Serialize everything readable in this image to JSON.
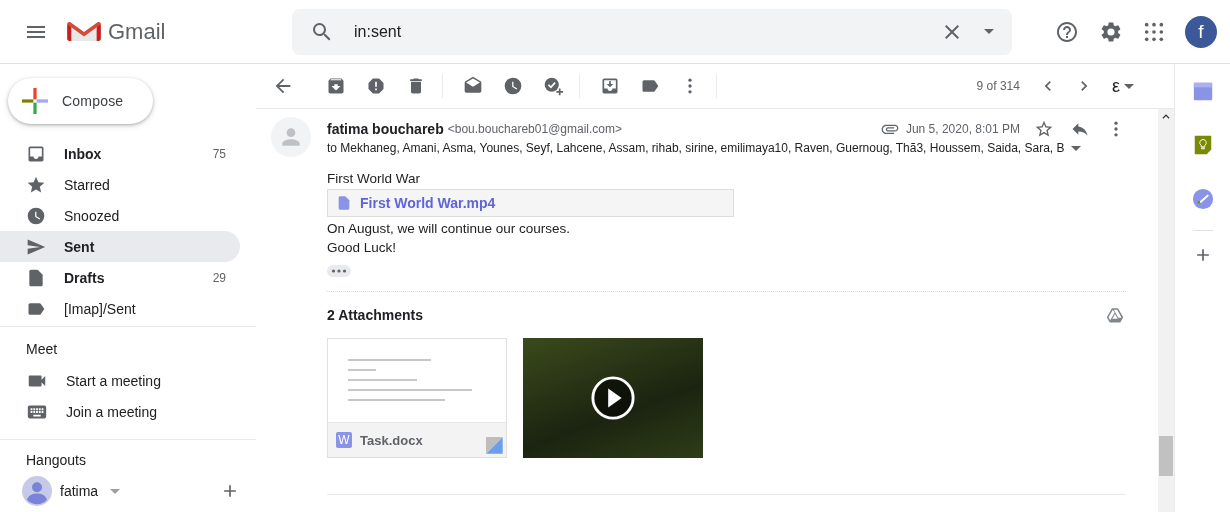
{
  "header": {
    "app_name": "Gmail",
    "search": {
      "value": "in:sent"
    },
    "avatar_letter": "f"
  },
  "compose": {
    "label": "Compose"
  },
  "folders": [
    {
      "kind": "inbox",
      "label": "Inbox",
      "count": "75",
      "unread": true,
      "selected": false
    },
    {
      "kind": "starred",
      "label": "Starred",
      "unread": false,
      "selected": false
    },
    {
      "kind": "snoozed",
      "label": "Snoozed",
      "unread": false,
      "selected": false
    },
    {
      "kind": "sent",
      "label": "Sent",
      "unread": true,
      "selected": true
    },
    {
      "kind": "drafts",
      "label": "Drafts",
      "count": "29",
      "unread": true,
      "selected": false
    },
    {
      "kind": "label",
      "label": "[Imap]/Sent",
      "unread": false,
      "selected": false
    }
  ],
  "meet": {
    "title": "Meet",
    "items": [
      {
        "kind": "video",
        "label": "Start a meeting"
      },
      {
        "kind": "keyboard",
        "label": "Join a meeting"
      }
    ]
  },
  "hangouts": {
    "title": "Hangouts",
    "user": "fatima"
  },
  "toolbar": {
    "position": "9 of 314",
    "input_tool": "ε"
  },
  "message": {
    "sender_name": "fatima bouchareb",
    "sender_email": "<bou.bouchareb01@gmail.com>",
    "date": "Jun 5, 2020, 8:01 PM",
    "has_attachment": true,
    "recipients": "to Mekhaneg, Amani, Asma, Younes, Seyf, Lahcene, Assam, rihab, sirine, emilimaya10, Raven, Guernoug, Thã3, Houssem, Saida, Sara, B",
    "body": [
      {
        "kind": "text",
        "text": "First World War"
      },
      {
        "kind": "drive_link",
        "text": "First World War.mp4"
      },
      {
        "kind": "text",
        "text": "On August, we will continue our courses."
      },
      {
        "kind": "text",
        "text": "Good Luck!"
      }
    ]
  },
  "attachments": {
    "title": "2 Attachments",
    "items": [
      {
        "kind": "document",
        "badge": "W",
        "name": "Task.docx"
      },
      {
        "kind": "video"
      }
    ]
  }
}
